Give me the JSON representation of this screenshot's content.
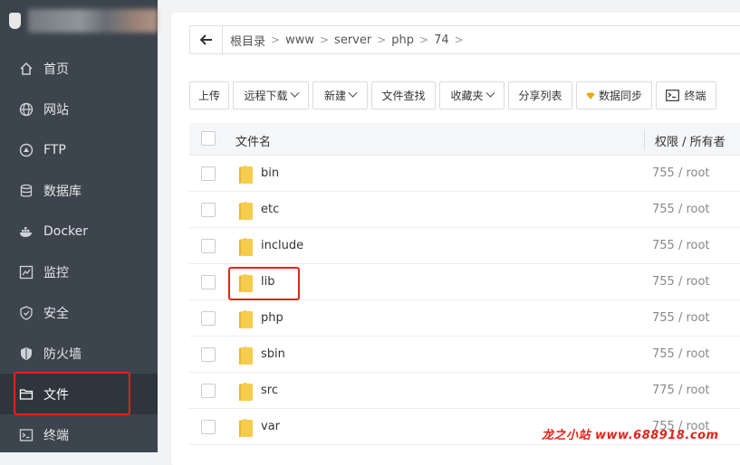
{
  "sidebar": {
    "items": [
      {
        "label": "首页",
        "icon": "home-icon"
      },
      {
        "label": "网站",
        "icon": "globe-icon"
      },
      {
        "label": "FTP",
        "icon": "ftp-icon"
      },
      {
        "label": "数据库",
        "icon": "database-icon"
      },
      {
        "label": "Docker",
        "icon": "docker-icon"
      },
      {
        "label": "监控",
        "icon": "monitor-icon"
      },
      {
        "label": "安全",
        "icon": "shield-icon"
      },
      {
        "label": "防火墙",
        "icon": "firewall-icon"
      },
      {
        "label": "文件",
        "icon": "folder-icon",
        "active": true
      },
      {
        "label": "终端",
        "icon": "terminal-icon"
      }
    ]
  },
  "breadcrumb": [
    "根目录",
    "www",
    "server",
    "php",
    "74"
  ],
  "toolbar": {
    "upload": "上传",
    "remote_download": "远程下载",
    "new": "新建",
    "file_search": "文件查找",
    "favorites": "收藏夹",
    "share_list": "分享列表",
    "data_sync": "数据同步",
    "terminal": "终端"
  },
  "table": {
    "headers": {
      "name": "文件名",
      "perm": "权限 / 所有者"
    },
    "rows": [
      {
        "name": "bin",
        "perm": "755 / root"
      },
      {
        "name": "etc",
        "perm": "755 / root"
      },
      {
        "name": "include",
        "perm": "755 / root"
      },
      {
        "name": "lib",
        "perm": "755 / root"
      },
      {
        "name": "php",
        "perm": "755 / root"
      },
      {
        "name": "sbin",
        "perm": "755 / root"
      },
      {
        "name": "src",
        "perm": "775 / root"
      },
      {
        "name": "var",
        "perm": "755 / root"
      }
    ]
  },
  "watermark": "龙之小站 www.688918.com",
  "colors": {
    "sidebar": "#3c444d",
    "highlight": "#e2231a",
    "folder": "#f5c542"
  }
}
